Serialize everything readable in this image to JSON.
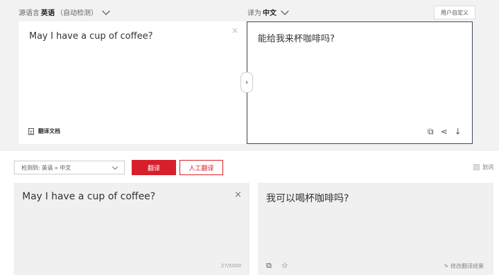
{
  "top": {
    "source_lang": {
      "prefix": "源语言",
      "name": "英语",
      "hint": "（自动检测）"
    },
    "target_lang": {
      "prefix": "译为",
      "name": "中文"
    },
    "custom_button": "用户自定义",
    "source_text": "May I have a cup of coffee?",
    "target_text": "能给我来杯咖啡吗?",
    "doc_link": "翻译文档",
    "close_symbol": "×",
    "swap_symbol": "›",
    "tool_icons": [
      {
        "name": "copy-icon",
        "glyph": "⧉"
      },
      {
        "name": "share-icon",
        "glyph": "⋖"
      },
      {
        "name": "download-icon",
        "glyph": "↓"
      }
    ]
  },
  "bottom": {
    "detect_select": "检测到: 英语 » 中文",
    "translate_button": "翻译",
    "human_button": "人工翻译",
    "word_toggle": "划词",
    "source_text": "May I have a cup of coffee?",
    "target_text": "我可以喝杯咖啡吗?",
    "char_count": "27/5000",
    "edit_result": "✎ 修改翻译结果",
    "close_symbol": "×",
    "icons": [
      {
        "name": "copy-icon",
        "glyph": "⧉"
      },
      {
        "name": "star-icon",
        "glyph": "☆"
      }
    ]
  },
  "colors": {
    "accent": "#d71f2b",
    "border": "#3a4a5c"
  }
}
